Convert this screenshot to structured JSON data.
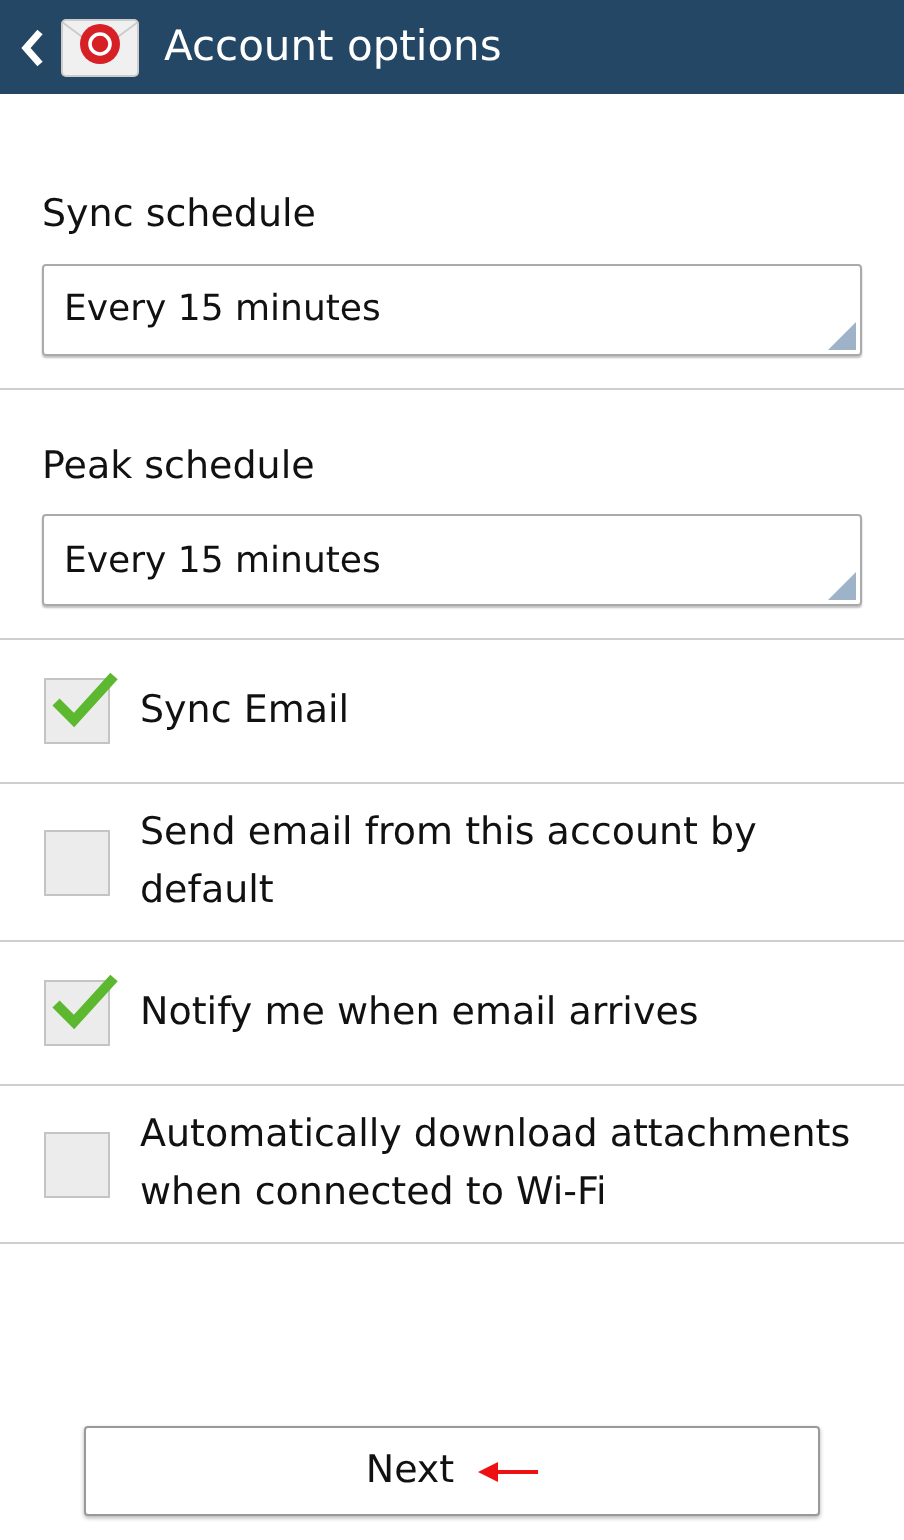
{
  "header": {
    "title": "Account options"
  },
  "schedules": [
    {
      "label": "Sync schedule",
      "value": "Every 15 minutes"
    },
    {
      "label": "Peak schedule",
      "value": "Every 15 minutes"
    }
  ],
  "options": [
    {
      "label": "Sync Email",
      "checked": true
    },
    {
      "label": "Send email from this account by default",
      "checked": false
    },
    {
      "label": "Notify me when email arrives",
      "checked": true
    },
    {
      "label": "Automatically download attachments when connected to Wi-Fi",
      "checked": false
    }
  ],
  "next_button": {
    "label": "Next"
  }
}
